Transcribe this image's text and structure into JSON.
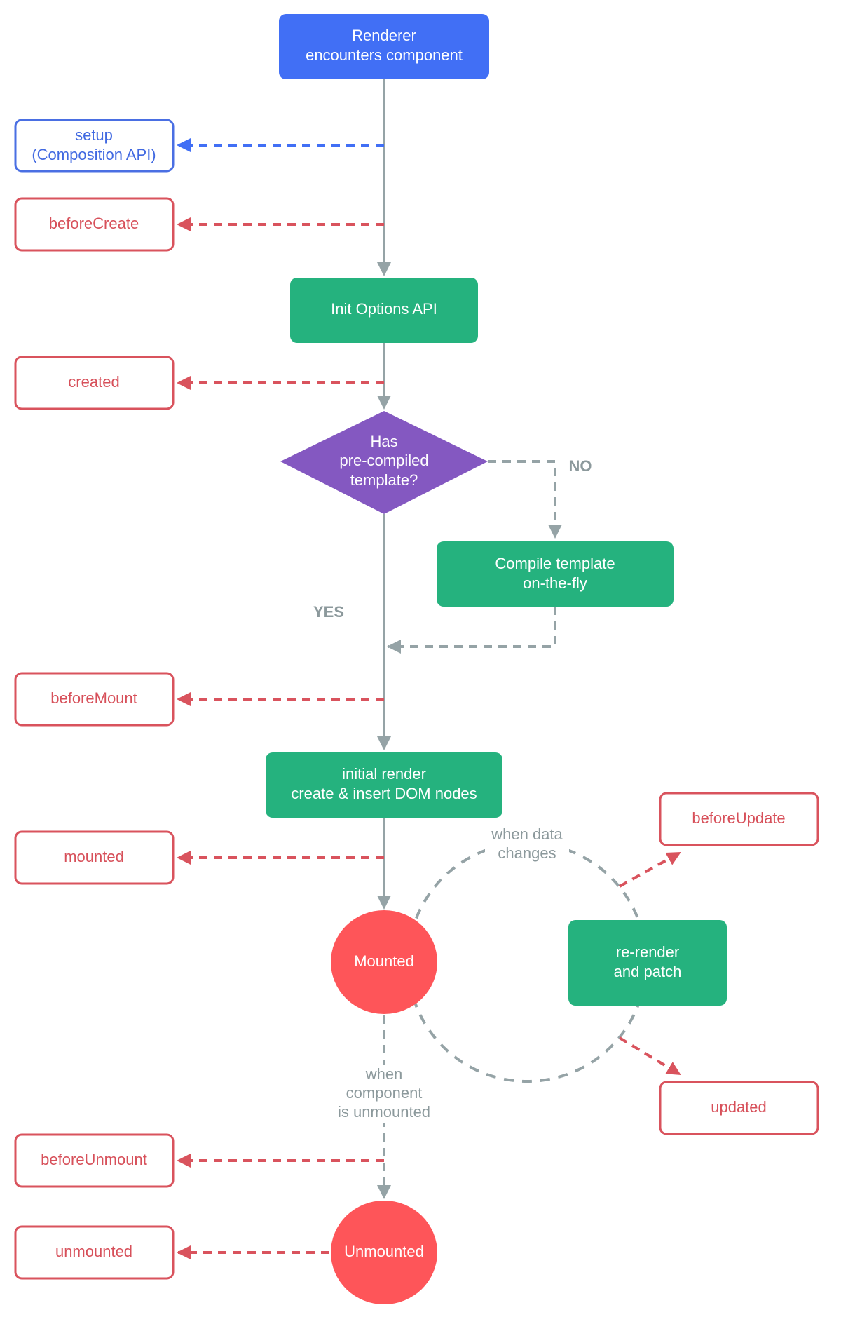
{
  "colors": {
    "blue": "#416ff5",
    "blue_outline": "#4a6fe3",
    "green": "#25b27e",
    "purple": "#8458c1",
    "red_fill": "#fe5559",
    "red_outline": "#d9535d",
    "gray": "#95a3a6"
  },
  "nodes": {
    "renderer": [
      "Renderer",
      "encounters component"
    ],
    "init_options": [
      "Init Options API"
    ],
    "decision": [
      "Has",
      "pre-compiled",
      "template?"
    ],
    "compile": [
      "Compile template",
      "on-the-fly"
    ],
    "initial_render": [
      "initial render",
      "create & insert DOM nodes"
    ],
    "mounted": [
      "Mounted"
    ],
    "rerender": [
      "re-render",
      "and patch"
    ],
    "unmounted": [
      "Unmounted"
    ]
  },
  "hooks": {
    "setup": [
      "setup",
      "(Composition API)"
    ],
    "beforeCreate": [
      "beforeCreate"
    ],
    "created": [
      "created"
    ],
    "beforeMount": [
      "beforeMount"
    ],
    "mounted": [
      "mounted"
    ],
    "beforeUpdate": [
      "beforeUpdate"
    ],
    "updated": [
      "updated"
    ],
    "beforeUnmount": [
      "beforeUnmount"
    ],
    "unmounted": [
      "unmounted"
    ]
  },
  "labels": {
    "no": "NO",
    "yes": "YES",
    "data_changes": [
      "when data",
      "changes"
    ],
    "component_unmounted": [
      "when",
      "component",
      "is unmounted"
    ]
  }
}
